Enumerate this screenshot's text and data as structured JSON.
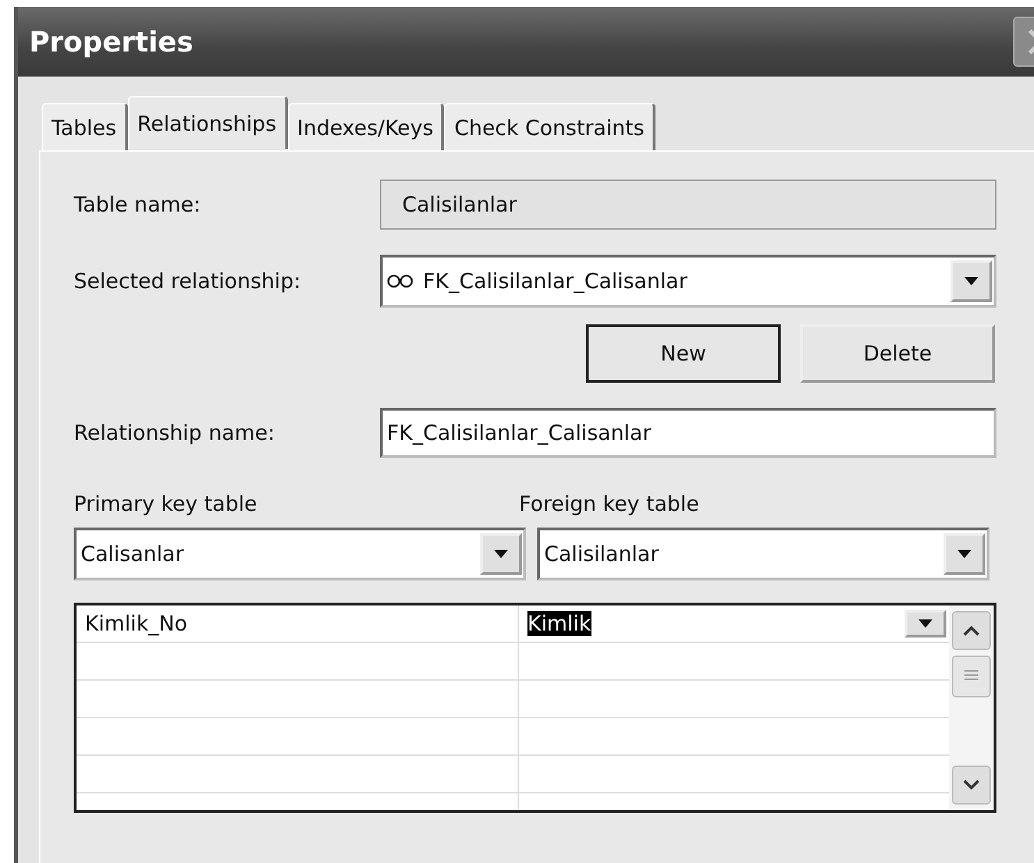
{
  "window": {
    "title": "Properties"
  },
  "tabs": [
    {
      "label": "Tables",
      "selected": false
    },
    {
      "label": "Relationships",
      "selected": true
    },
    {
      "label": "Indexes/Keys",
      "selected": false
    },
    {
      "label": "Check Constraints",
      "selected": false
    }
  ],
  "table_name": {
    "label": "Table name:",
    "value": "Calisilanlar",
    "readonly": true
  },
  "selected_relationship": {
    "label": "Selected relationship:",
    "value": "FK_Calisilanlar_Calisanlar"
  },
  "buttons": [
    {
      "label": "New",
      "default": true
    },
    {
      "label": "Delete",
      "default": false
    }
  ],
  "relationship_name": {
    "label": "Relationship name:",
    "value": "FK_Calisilanlar_Calisanlar"
  },
  "primary_key_table": {
    "label": "Primary key table",
    "value": "Calisanlar"
  },
  "foreign_key_table": {
    "label": "Foreign key table",
    "value": "Calisilanlar"
  },
  "columns_grid": {
    "rows": [
      {
        "primary": "Kimlik_No",
        "foreign": "Kimlik",
        "foreign_highlighted": true
      }
    ]
  }
}
